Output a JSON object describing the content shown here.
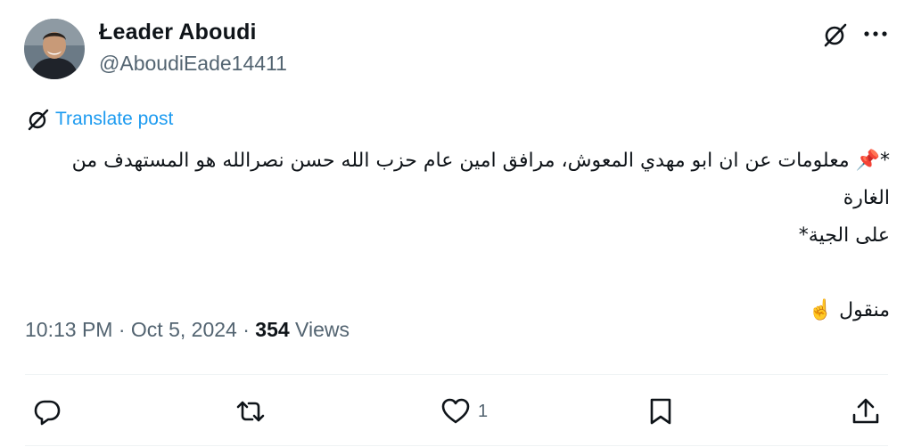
{
  "author": {
    "name": "Łeader Aboudi",
    "handle": "@AboudiEade14411",
    "avatar_icon": "profile-photo"
  },
  "header_icons": [
    "grok-icon",
    "more-icon"
  ],
  "translate": {
    "icon": "grok-icon",
    "label": "Translate post"
  },
  "post": {
    "line1": "*📌 معلومات عن ان ابو مهدي المعوش، مرافق امين عام حزب الله حسن نصرالله هو المستهدف من الغارة",
    "line2": "على الجية*",
    "line3": "منقول ☝️"
  },
  "meta": {
    "time": "10:13 PM",
    "sep1": " · ",
    "date": "Oct 5, 2024",
    "sep2": " · ",
    "views_count": "354",
    "views_label": " Views"
  },
  "actions": {
    "reply": {
      "icon": "reply-icon",
      "count": ""
    },
    "repost": {
      "icon": "repost-icon",
      "count": ""
    },
    "like": {
      "icon": "heart-icon",
      "count": "1"
    },
    "bookmark": {
      "icon": "bookmark-icon",
      "count": ""
    },
    "share": {
      "icon": "share-icon",
      "count": ""
    }
  },
  "colors": {
    "text": "#0f1419",
    "secondary": "#536471",
    "link": "#1d9bf0",
    "divider": "#eff3f4"
  }
}
